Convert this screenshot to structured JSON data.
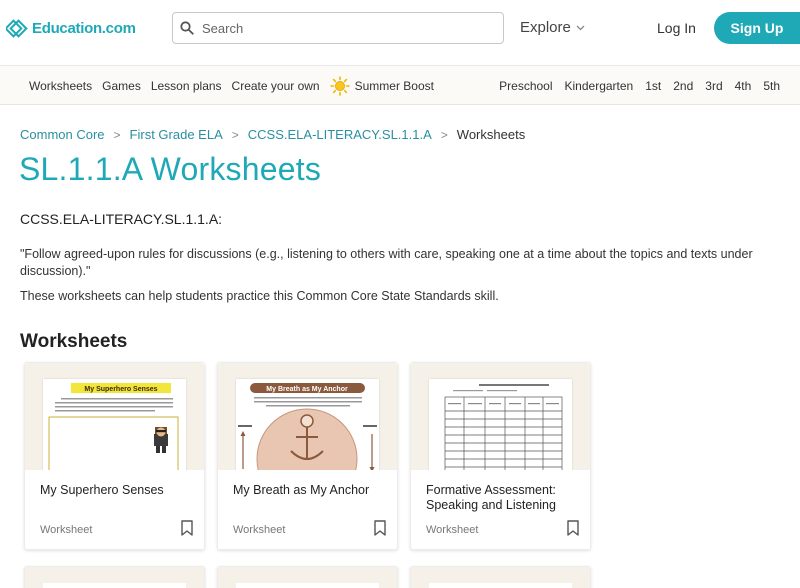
{
  "header": {
    "logo_text": "Education.com",
    "search_placeholder": "Search",
    "explore_label": "Explore",
    "login_label": "Log In",
    "signup_label": "Sign Up"
  },
  "subnav": {
    "left_items": [
      "Worksheets",
      "Games",
      "Lesson plans",
      "Create your own"
    ],
    "summer_label": "Summer Boost",
    "grades": [
      "Preschool",
      "Kindergarten",
      "1st",
      "2nd",
      "3rd",
      "4th",
      "5th"
    ]
  },
  "breadcrumb": {
    "items": [
      "Common Core",
      "First Grade ELA",
      "CCSS.ELA-LITERACY.SL.1.1.A"
    ],
    "current": "Worksheets",
    "separator": ">"
  },
  "page": {
    "title": "SL.1.1.A Worksheets",
    "standard_code": "CCSS.ELA-LITERACY.SL.1.1.A",
    "standard_suffix": ":",
    "quote": "\"Follow agreed-upon rules for discussions (e.g., listening to others with care, speaking one at a time about the topics and texts under discussion).\"",
    "helper": "These worksheets can help students practice this Common Core State Standards skill.",
    "section_title": "Worksheets"
  },
  "cards": [
    {
      "title": "My Superhero Senses",
      "type": "Worksheet",
      "thumb_heading": "My Superhero Senses"
    },
    {
      "title": "My Breath as My Anchor",
      "type": "Worksheet",
      "thumb_heading": "My Breath as My Anchor"
    },
    {
      "title": "Formative Assessment: Speaking and Listening",
      "type": "Worksheet",
      "thumb_heading": ""
    }
  ],
  "colors": {
    "brand": "#1fa9b7",
    "link": "#2a8fa0",
    "subnav_bg": "#fcfaf6",
    "card_thumb_bg": "#f6f1e8"
  }
}
